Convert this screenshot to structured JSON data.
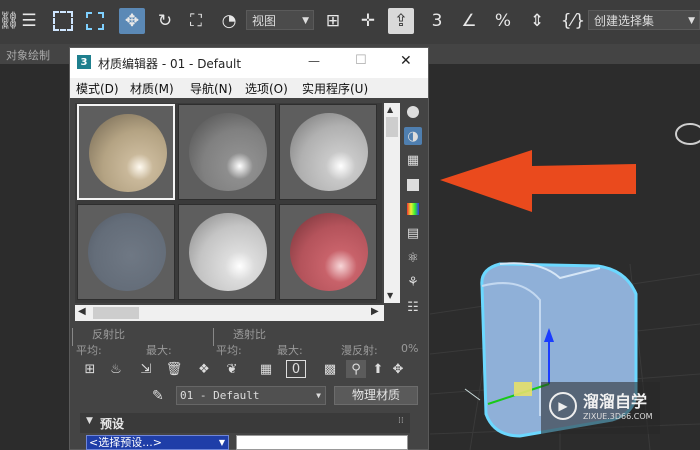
{
  "toolbar": {
    "view_dropdown": "视图",
    "selection_set_dropdown": "创建选择集",
    "tool_icons": [
      "link-icon",
      "list-icon",
      "select-rect-icon",
      "select-region-icon",
      "move-icon",
      "rotate-icon",
      "scale-icon",
      "selection-filter-icon",
      "pivot-icon",
      "manipulate-icon",
      "snap-3-icon",
      "angle-snap-icon",
      "percent-snap-icon",
      "spinner-snap-icon",
      "named-sets-icon"
    ]
  },
  "subbar": {
    "label": "对象绘制"
  },
  "material_editor": {
    "title": "材质编辑器 - 01 - Default",
    "window_controls": {
      "minimize": "—",
      "maximize": "☐",
      "close": "✕"
    },
    "menu": [
      "模式(D)",
      "材质(M)",
      "导航(N)",
      "选项(O)",
      "实用程序(U)"
    ],
    "slots": [
      {
        "color": "#c9b89a",
        "selected": true
      },
      {
        "color": "#8e8e8e",
        "selected": false
      },
      {
        "color": "#c2c2c2",
        "selected": false
      },
      {
        "color": "#6a7380",
        "selected": false
      },
      {
        "color": "#d6d6d6",
        "selected": false
      },
      {
        "color": "#c05a62",
        "selected": false
      }
    ],
    "labels": {
      "reflect": "反射比",
      "transmit": "透射比",
      "avg1": "平均:",
      "max1": "最大:",
      "avg2": "平均:",
      "max2": "最大:",
      "diffuse": "漫反射:",
      "diffuse_val": "0%"
    },
    "material_name": "01 - Default",
    "material_type_button": "物理材质",
    "rollout_title": "预设",
    "preset_select": "<选择预设...>"
  },
  "watermark": {
    "text": "溜溜自学",
    "url": "ZIXUE.3D66.COM"
  }
}
